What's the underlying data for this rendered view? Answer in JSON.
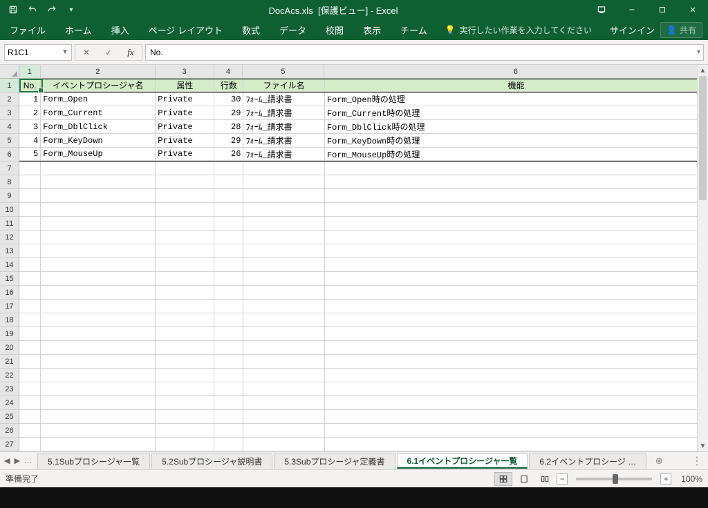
{
  "title": {
    "file": "DocAcs.xls",
    "mode": "[保護ビュー]",
    "app": "Excel"
  },
  "ribbon": {
    "tabs": [
      "ファイル",
      "ホーム",
      "挿入",
      "ページ レイアウト",
      "数式",
      "データ",
      "校閲",
      "表示",
      "チーム"
    ],
    "search_placeholder": "実行したい作業を入力してください",
    "signin": "サインイン",
    "share": "共有"
  },
  "formula": {
    "name_box": "R1C1",
    "value": "No."
  },
  "grid": {
    "col_labels": [
      "1",
      "2",
      "3",
      "4",
      "5",
      "6"
    ],
    "row_count": 27,
    "headers": [
      "No.",
      "イベントプロシージャ名",
      "属性",
      "行数",
      "ファイル名",
      "機能"
    ],
    "rows": [
      {
        "no": "1",
        "name": "Form_Open",
        "attr": "Private",
        "lines": "30",
        "file": "ﾌｫｰﾑ_請求書",
        "func": "Form_Open時の処理"
      },
      {
        "no": "2",
        "name": "Form_Current",
        "attr": "Private",
        "lines": "29",
        "file": "ﾌｫｰﾑ_請求書",
        "func": "Form_Current時の処理"
      },
      {
        "no": "3",
        "name": "Form_DblClick",
        "attr": "Private",
        "lines": "28",
        "file": "ﾌｫｰﾑ_請求書",
        "func": "Form_DblClick時の処理"
      },
      {
        "no": "4",
        "name": "Form_KeyDown",
        "attr": "Private",
        "lines": "29",
        "file": "ﾌｫｰﾑ_請求書",
        "func": "Form_KeyDown時の処理"
      },
      {
        "no": "5",
        "name": "Form_MouseUp",
        "attr": "Private",
        "lines": "26",
        "file": "ﾌｫｰﾑ_請求書",
        "func": "Form_MouseUp時の処理"
      }
    ]
  },
  "sheet_tabs": {
    "tabs": [
      "5.1Subプロシージャ一覧",
      "5.2Subプロシージャ説明書",
      "5.3Subプロシージャ定義書",
      "6.1イベントプロシージャ一覧",
      "6.2イベントプロシージ …"
    ],
    "active_index": 3
  },
  "status": {
    "ready": "準備完了",
    "zoom": "100%"
  }
}
